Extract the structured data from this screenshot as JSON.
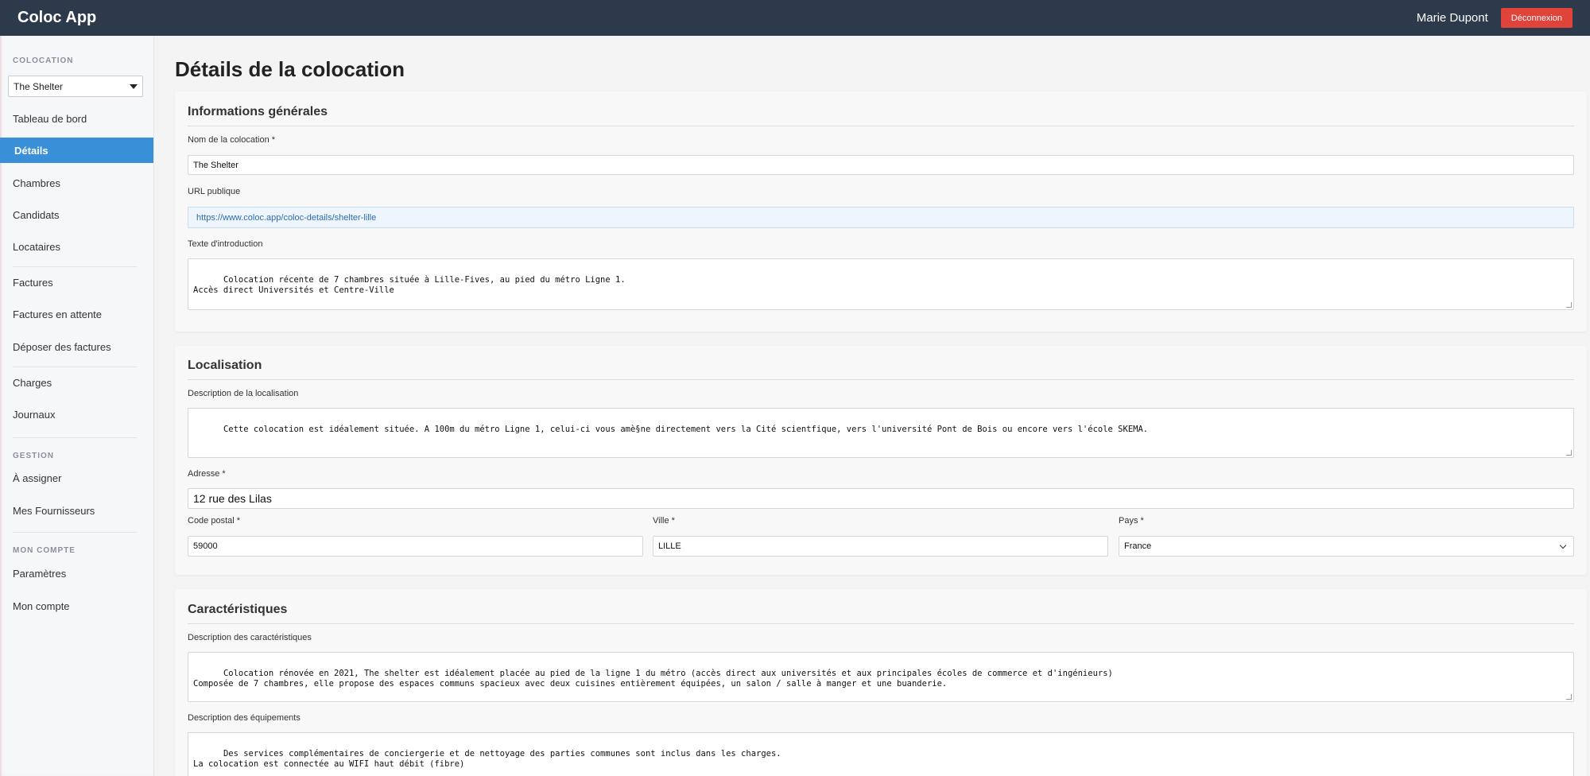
{
  "header": {
    "brand": "Coloc App",
    "user_name": "Marie Dupont",
    "logout_label": "Déconnexion"
  },
  "sidebar": {
    "section_colocation": "COLOCATION",
    "coloc_selected": "The Shelter",
    "items_group1": [
      "Tableau de bord",
      "Détails",
      "Chambres",
      "Candidats",
      "Locataires"
    ],
    "items_group2": [
      "Factures",
      "Factures en attente",
      "Déposer des factures"
    ],
    "items_group3": [
      "Charges",
      "Journaux"
    ],
    "section_gestion": "GESTION",
    "items_gestion": [
      "À assigner",
      "Mes Fournisseurs"
    ],
    "section_account": "MON COMPTE",
    "items_account": [
      "Paramètres",
      "Mon compte"
    ],
    "active_item": "Détails"
  },
  "page": {
    "title": "Détails de la colocation"
  },
  "general": {
    "title": "Informations générales",
    "name_label": "Nom de la colocation *",
    "name_value": "The Shelter",
    "url_label": "URL publique",
    "url_value": "https://www.coloc.app/coloc-details/shelter-lille",
    "intro_label": "Texte d'introduction",
    "intro_value": "Colocation récente de 7 chambres située à Lille-Fives, au pied du métro Ligne 1.\nAccès direct Universités et Centre-Ville"
  },
  "location": {
    "title": "Localisation",
    "desc_label": "Description de la localisation",
    "desc_value": "Cette colocation est idéalement située. A 100m du métro Ligne 1, celui-ci vous amè§ne directement vers la Cité scientfique, vers l'université Pont de Bois ou encore vers l'école SKEMA.",
    "address_label": "Adresse *",
    "address_value": "12 rue des Lilas",
    "postal_label": "Code postal *",
    "postal_value": "59000",
    "city_label": "Ville *",
    "city_value": "LILLE",
    "country_label": "Pays *",
    "country_value": "France"
  },
  "features": {
    "title": "Caractéristiques",
    "desc_label": "Description des caractéristiques",
    "desc_value": "Colocation rénovée en 2021, The shelter est idéalement placée au pied de la ligne 1 du métro (accès direct aux universités et aux principales écoles de commerce et d'ingénieurs)\nComposée de 7 chambres, elle propose des espaces communs spacieux avec deux cuisines entièrement équipées, un salon / salle à manger et une buanderie.",
    "equip_label": "Description des équipements",
    "equip_value": "Des services complémentaires de conciergerie et de nettoyage des parties communes sont inclus dans les charges.\nLa colocation est connectée au WIFI haut débit (fibre)"
  }
}
